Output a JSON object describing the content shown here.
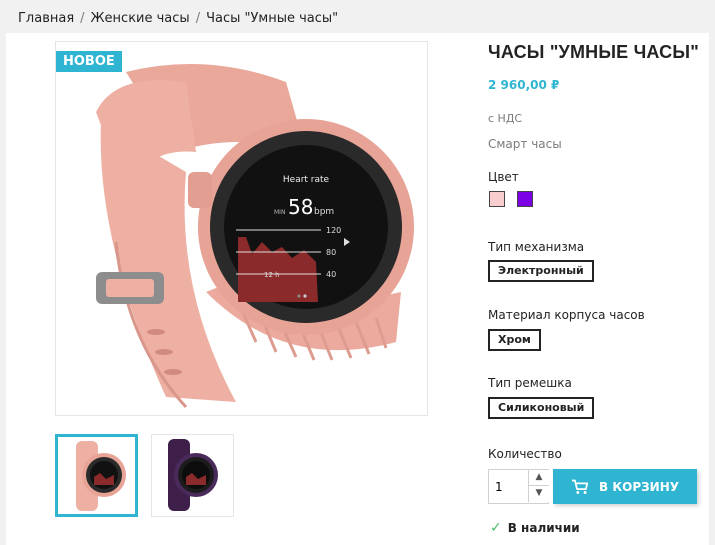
{
  "breadcrumb": {
    "items": [
      "Главная",
      "Женские часы",
      "Часы \"Умные часы\""
    ],
    "separator": "/"
  },
  "product": {
    "badge": "НОВОЕ",
    "title": "ЧАСЫ \"УМНЫЕ ЧАСЫ\"",
    "price": "2 960,00 ₽",
    "tax_label": "с НДС",
    "short_description": "Смарт часы"
  },
  "watch_screen": {
    "heading": "Heart rate",
    "min_label": "MIN",
    "value": "58",
    "unit": "bpm",
    "scale": [
      "120",
      "80",
      "40"
    ],
    "time_label": "12 h"
  },
  "attributes": {
    "color": {
      "label": "Цвет",
      "swatches": [
        {
          "name": "pink",
          "hex": "#f7cdcd"
        },
        {
          "name": "purple",
          "hex": "#7b00e5"
        }
      ]
    },
    "mechanism": {
      "label": "Тип механизма",
      "value": "Электронный"
    },
    "case_material": {
      "label": "Материал корпуса часов",
      "value": "Хром"
    },
    "strap": {
      "label": "Тип ремешка",
      "value": "Силиконовый"
    }
  },
  "purchase": {
    "quantity_label": "Количество",
    "quantity_value": "1",
    "add_to_cart_label": "В КОРЗИНУ",
    "availability": "В наличии"
  },
  "colors": {
    "accent": "#2fb5d2",
    "text": "#232323",
    "muted": "#7a7a7a",
    "success": "#4cbb6c",
    "strap_pink": "#e9a89a"
  },
  "icons": {
    "cart": "shopping-cart-icon",
    "check": "check-icon",
    "chevron_up": "chevron-up-icon",
    "chevron_down": "chevron-down-icon"
  }
}
